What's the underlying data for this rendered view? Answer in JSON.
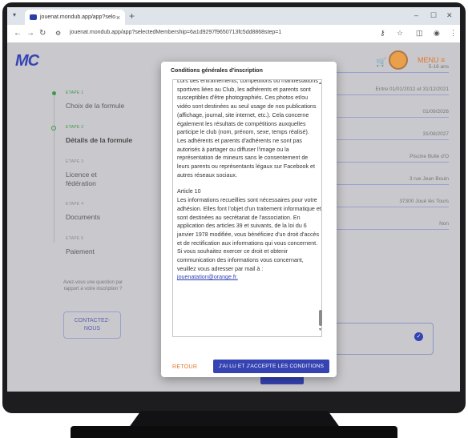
{
  "browser": {
    "tab_title": "jouenat.mondub.app/app?selo",
    "tab_close": "×",
    "new_tab": "+",
    "url": "jouenat.mondub.app/app?selectedMembership=6a1d9297f9650713fc5dd8868step=1"
  },
  "header": {
    "logo": "MC",
    "menu_label": "MENU ≡"
  },
  "steps": [
    {
      "small": "ETAPE 1",
      "title": "Choix de la formule"
    },
    {
      "small": "ETAPE 2",
      "title": "Détails de la formule"
    },
    {
      "small": "ETAPE 3",
      "title": "Licence et",
      "title2": "fédération"
    },
    {
      "small": "ETAPE 4",
      "title": "Documents"
    },
    {
      "small": "ETAPE 5",
      "title": "Paiement"
    }
  ],
  "help": {
    "text": "Avez-vous une question par rapport à votre inscription ?",
    "contact_line1": "CONTACTEZ-",
    "contact_line2": "NOUS"
  },
  "fields": [
    "5-16 ans",
    "Entre 01/01/2012 et 31/12/2021",
    "01/09/2026",
    "31/08/2027",
    "Piscine Bulle d'O",
    "3 rue Jean Bouin",
    "37300 Joué lès Tours",
    "Non"
  ],
  "modal": {
    "title": "Conditions générales d'inscription",
    "paragraphs": [
      "Lors des entraînements, compétitions ou manifestations sportives liées au Club, les adhérents et parents sont susceptibles d'être photographiés. Ces photos et/ou vidéo sont destinées au seul usage de nos publications (affichage, journal, site internet, etc.). Cela concerne également les résultats de compétitions auxquelles participe le club (nom, prénom, sexe, temps réalisé).",
      "Les adhérents et parents d'adhérents ne sont pas autorisés à partager ou diffuser l'image ou la représentation de mineurs sans le consentement de leurs parents ou représentants légaux sur Facebook et autres réseaux sociaux.",
      "Article 10",
      "Les informations recueillies sont nécessaires pour votre adhésion. Elles font l'objet d'un traitement informatique et sont destinées au secrétariat de l'association. En application des articles 39 et suivants, de la loi du 6 janvier 1978 modifiée, vous bénéficiez d'un droit d'accès et de rectification aux informations qui vous concernent. Si vous souhaitez exercer ce droit et obtenir communication des informations vous concernant, veuillez vous adresser par mail à :"
    ],
    "email": "jouenatation@orange.fr.",
    "back_label": "RETOUR",
    "accept_label": "J'AI LU ET J'ACCEPTE LES CONDITIONS"
  },
  "colors": {
    "brand": "#3543b3",
    "accent": "#e0762a",
    "done": "#3c9a4a"
  }
}
